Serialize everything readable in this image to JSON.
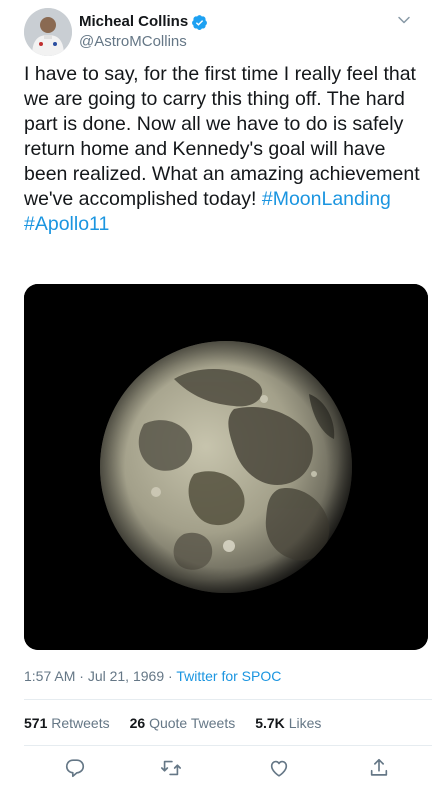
{
  "author": {
    "display_name": "Micheal Collins",
    "handle": "@AstroMCollins",
    "verified": true
  },
  "icons": {
    "verified": "verified-badge-icon",
    "more": "chevron-down-icon",
    "reply": "reply-icon",
    "retweet": "retweet-icon",
    "like": "heart-icon",
    "share": "share-icon"
  },
  "tweet": {
    "text": "I have to say, for the first time I really feel that we are going to carry this thing off. The hard part is done. Now all we have to do is safely return home and Kennedy's goal will have been realized. What an amazing achievement we've accomplished today!",
    "hashtags": [
      "#MoonLanding",
      "#Apollo11"
    ]
  },
  "meta": {
    "time": "1:57 AM",
    "separator1": " · ",
    "date": "Jul 21, 1969",
    "separator2": " · ",
    "source": "Twitter for SPOC"
  },
  "stats": {
    "retweets_count": "571",
    "retweets_label": "Retweets",
    "quotes_count": "26",
    "quotes_label": "Quote Tweets",
    "likes_count": "5.7K",
    "likes_label": "Likes"
  },
  "colors": {
    "link": "#1b95e0",
    "secondary_text": "#657786",
    "verified": "#1da1f2",
    "divider": "#e6ecf0"
  }
}
